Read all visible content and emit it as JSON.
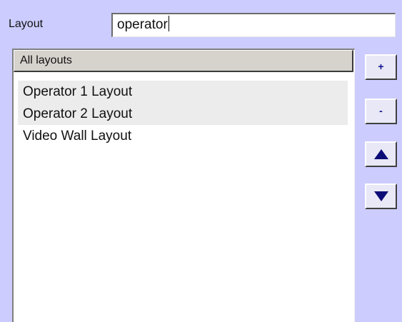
{
  "layout_field": {
    "label": "Layout",
    "value": "operator"
  },
  "list": {
    "header": "All layouts",
    "items": [
      {
        "label": "Operator 1 Layout"
      },
      {
        "label": "Operator 2 Layout"
      },
      {
        "label": "Video Wall Layout"
      }
    ]
  },
  "side_buttons": {
    "add_label": "+",
    "remove_label": "-",
    "up_icon": "arrow-up-icon",
    "down_icon": "arrow-down-icon"
  },
  "colors": {
    "background": "#ccccff",
    "arrow": "#0b0b78"
  }
}
